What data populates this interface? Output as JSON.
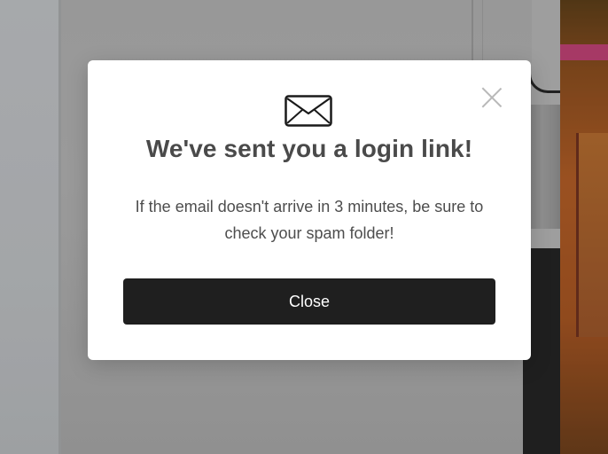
{
  "modal": {
    "title": "We've sent you a login link!",
    "message": "If the email doesn't arrive in 3 minutes, be sure to check your spam folder!",
    "close_button_label": "Close",
    "icons": {
      "mail": "mail-icon",
      "close": "close-icon"
    }
  },
  "colors": {
    "modal_background": "#ffffff",
    "title_text": "#4a4a4a",
    "message_text": "#4d4d4d",
    "button_background": "#1f1f1f",
    "button_text": "#ffffff",
    "close_icon": "#b8b8b8"
  }
}
